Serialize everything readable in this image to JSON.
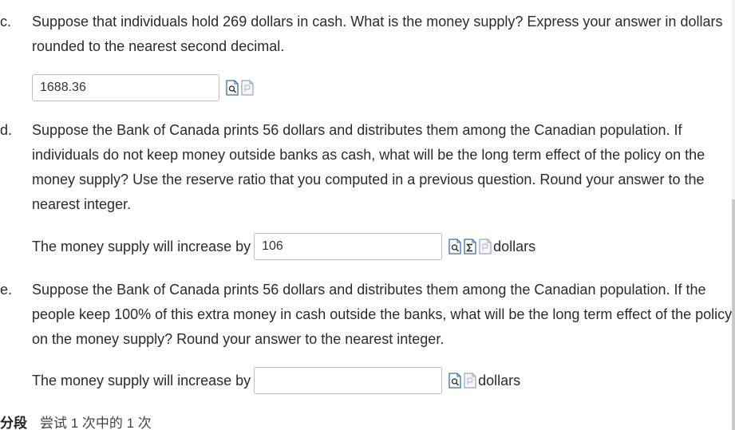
{
  "questions": {
    "c": {
      "prefix": "c.",
      "text": "Suppose that individuals hold 269 dollars in cash. What is the money supply? Express your answer in dollars rounded to the nearest second decimal.",
      "answer_value": "1688.36"
    },
    "d": {
      "prefix": "d.",
      "text": "Suppose the Bank of Canada prints 56 dollars and distributes them among the Canadian population. If individuals do not keep money outside banks as cash, what will be the long term effect of the policy on the money supply? Use the reserve ratio that you computed in a previous question. Round your answer to the nearest integer.",
      "lead_label": "The money supply will increase by",
      "answer_value": "106",
      "unit_label": "dollars"
    },
    "e": {
      "prefix": "e.",
      "text": "Suppose the Bank of Canada prints 56 dollars and distributes them among the Canadian population. If the people keep 100% of this extra money in cash outside the banks, what will be the long term effect of the policy on the money supply? Round your answer to the nearest integer.",
      "lead_label": "The money supply will increase by",
      "answer_value": "",
      "unit_label": "dollars"
    }
  },
  "footer": {
    "part_label": "分段",
    "attempt_label": "尝试 1 次中的 1 次"
  },
  "icons": {
    "check": "check-answer-icon",
    "sigma": "equation-editor-icon",
    "doc": "view-document-icon"
  },
  "colors": {
    "icon_blue": "#3a6fb0",
    "icon_gray": "#9aa6b8",
    "input_border": "#bdbdbd",
    "text": "#2b2b2b"
  }
}
